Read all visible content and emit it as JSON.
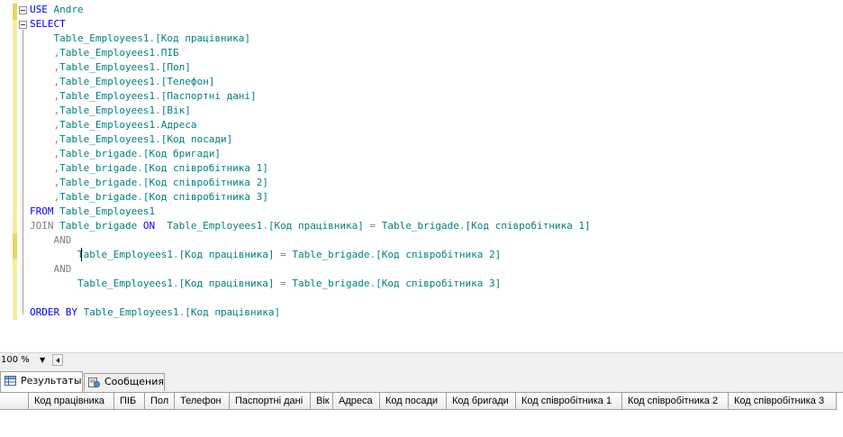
{
  "editor": {
    "lines": [
      [
        {
          "c": "kw",
          "t": "USE "
        },
        {
          "c": "id",
          "t": "Andre"
        }
      ],
      [
        {
          "c": "kw",
          "t": "SELECT"
        }
      ],
      [
        {
          "c": "tx",
          "t": "    "
        },
        {
          "c": "id",
          "t": "Table_Employees1"
        },
        {
          "c": "gr",
          "t": "."
        },
        {
          "c": "id",
          "t": "[Код працівника]"
        }
      ],
      [
        {
          "c": "tx",
          "t": "    "
        },
        {
          "c": "gr",
          "t": ","
        },
        {
          "c": "id",
          "t": "Table_Employees1"
        },
        {
          "c": "gr",
          "t": "."
        },
        {
          "c": "id",
          "t": "ПІБ"
        }
      ],
      [
        {
          "c": "tx",
          "t": "    "
        },
        {
          "c": "gr",
          "t": ","
        },
        {
          "c": "id",
          "t": "Table_Employees1"
        },
        {
          "c": "gr",
          "t": "."
        },
        {
          "c": "id",
          "t": "[Пол]"
        }
      ],
      [
        {
          "c": "tx",
          "t": "    "
        },
        {
          "c": "gr",
          "t": ","
        },
        {
          "c": "id",
          "t": "Table_Employees1"
        },
        {
          "c": "gr",
          "t": "."
        },
        {
          "c": "id",
          "t": "[Телефон]"
        }
      ],
      [
        {
          "c": "tx",
          "t": "    "
        },
        {
          "c": "gr",
          "t": ","
        },
        {
          "c": "id",
          "t": "Table_Employees1"
        },
        {
          "c": "gr",
          "t": "."
        },
        {
          "c": "id",
          "t": "[Паспортні дані]"
        }
      ],
      [
        {
          "c": "tx",
          "t": "    "
        },
        {
          "c": "gr",
          "t": ","
        },
        {
          "c": "id",
          "t": "Table_Employees1"
        },
        {
          "c": "gr",
          "t": "."
        },
        {
          "c": "id",
          "t": "[Вік]"
        }
      ],
      [
        {
          "c": "tx",
          "t": "    "
        },
        {
          "c": "gr",
          "t": ","
        },
        {
          "c": "id",
          "t": "Table_Employees1"
        },
        {
          "c": "gr",
          "t": "."
        },
        {
          "c": "id",
          "t": "Адреса"
        }
      ],
      [
        {
          "c": "tx",
          "t": "    "
        },
        {
          "c": "gr",
          "t": ","
        },
        {
          "c": "id",
          "t": "Table_Employees1"
        },
        {
          "c": "gr",
          "t": "."
        },
        {
          "c": "id",
          "t": "[Код посади]"
        }
      ],
      [
        {
          "c": "tx",
          "t": "    "
        },
        {
          "c": "gr",
          "t": ","
        },
        {
          "c": "id",
          "t": "Table_brigade"
        },
        {
          "c": "gr",
          "t": "."
        },
        {
          "c": "id",
          "t": "[Код бригади]"
        }
      ],
      [
        {
          "c": "tx",
          "t": "    "
        },
        {
          "c": "gr",
          "t": ","
        },
        {
          "c": "id",
          "t": "Table_brigade"
        },
        {
          "c": "gr",
          "t": "."
        },
        {
          "c": "id",
          "t": "[Код співробітника 1]"
        }
      ],
      [
        {
          "c": "tx",
          "t": "    "
        },
        {
          "c": "gr",
          "t": ","
        },
        {
          "c": "id",
          "t": "Table_brigade"
        },
        {
          "c": "gr",
          "t": "."
        },
        {
          "c": "id",
          "t": "[Код співробітника 2]"
        }
      ],
      [
        {
          "c": "tx",
          "t": "    "
        },
        {
          "c": "gr",
          "t": ","
        },
        {
          "c": "id",
          "t": "Table_brigade"
        },
        {
          "c": "gr",
          "t": "."
        },
        {
          "c": "id",
          "t": "[Код співробітника 3]"
        }
      ],
      [
        {
          "c": "kw",
          "t": "FROM "
        },
        {
          "c": "id",
          "t": "Table_Employees1"
        }
      ],
      [
        {
          "c": "gr",
          "t": "JOIN "
        },
        {
          "c": "id",
          "t": "Table_brigade "
        },
        {
          "c": "kw",
          "t": "ON"
        },
        {
          "c": "tx",
          "t": "  "
        },
        {
          "c": "id",
          "t": "Table_Employees1"
        },
        {
          "c": "gr",
          "t": "."
        },
        {
          "c": "id",
          "t": "[Код працівника] "
        },
        {
          "c": "gr",
          "t": "="
        },
        {
          "c": "id",
          "t": " Table_brigade"
        },
        {
          "c": "gr",
          "t": "."
        },
        {
          "c": "id",
          "t": "[Код співробітника 1]"
        }
      ],
      [
        {
          "c": "tx",
          "t": "    "
        },
        {
          "c": "gr",
          "t": "AND"
        }
      ],
      [
        {
          "c": "tx",
          "t": "        "
        },
        {
          "c": "id",
          "t": "Table_Employees1"
        },
        {
          "c": "gr",
          "t": "."
        },
        {
          "c": "id",
          "t": "[Код працівника] "
        },
        {
          "c": "gr",
          "t": "="
        },
        {
          "c": "id",
          "t": " Table_brigade"
        },
        {
          "c": "gr",
          "t": "."
        },
        {
          "c": "id",
          "t": "[Код співробітника 2]"
        }
      ],
      [
        {
          "c": "tx",
          "t": "    "
        },
        {
          "c": "gr",
          "t": "AND"
        }
      ],
      [
        {
          "c": "tx",
          "t": "        "
        },
        {
          "c": "id",
          "t": "Table_Employees1"
        },
        {
          "c": "gr",
          "t": "."
        },
        {
          "c": "id",
          "t": "[Код працівника] "
        },
        {
          "c": "gr",
          "t": "="
        },
        {
          "c": "id",
          "t": " Table_brigade"
        },
        {
          "c": "gr",
          "t": "."
        },
        {
          "c": "id",
          "t": "[Код співробітника 3]"
        }
      ],
      [
        {
          "c": "tx",
          "t": ""
        }
      ],
      [
        {
          "c": "kw",
          "t": "ORDER BY "
        },
        {
          "c": "id",
          "t": "Table_Employees1"
        },
        {
          "c": "gr",
          "t": "."
        },
        {
          "c": "id",
          "t": "[Код працівника]"
        }
      ]
    ]
  },
  "zoom": {
    "value": "100 %"
  },
  "tabs": [
    {
      "label": "Результаты",
      "icon": "results-grid-icon",
      "active": true
    },
    {
      "label": "Сообщения",
      "icon": "messages-icon",
      "active": false
    }
  ],
  "grid": {
    "columns": [
      "Код працівника",
      "ПІБ",
      "Пол",
      "Телефон",
      "Паспортні дані",
      "Вік",
      "Адреса",
      "Код посади",
      "Код бригади",
      "Код співробітника 1",
      "Код співробітника 2",
      "Код співробітника 3"
    ]
  },
  "colors": {
    "keyword": "#0000ff",
    "identifier": "#008080",
    "operator": "#808080",
    "change_bar": "#f6ee9a"
  }
}
